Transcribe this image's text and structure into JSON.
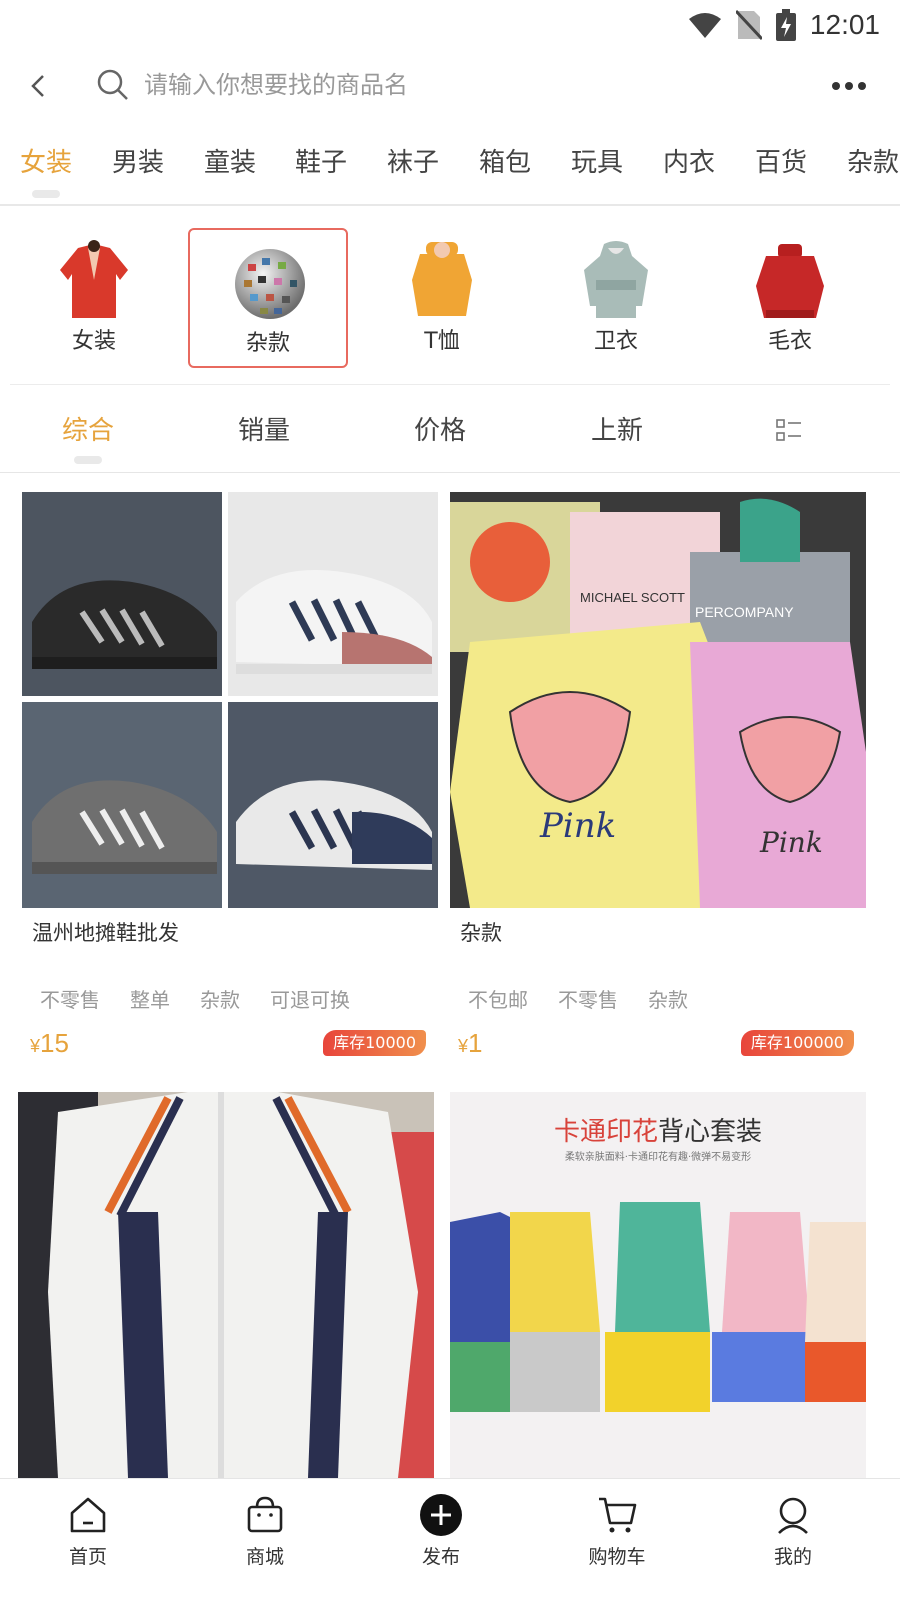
{
  "status_bar": {
    "time": "12:01"
  },
  "search": {
    "placeholder": "请输入你想要找的商品名"
  },
  "category_tabs": [
    {
      "label": "女装",
      "active": true
    },
    {
      "label": "男装"
    },
    {
      "label": "童装"
    },
    {
      "label": "鞋子"
    },
    {
      "label": "袜子"
    },
    {
      "label": "箱包"
    },
    {
      "label": "玩具"
    },
    {
      "label": "内衣"
    },
    {
      "label": "百货"
    },
    {
      "label": "杂款"
    }
  ],
  "subcategories": [
    {
      "label": "女装"
    },
    {
      "label": "杂款",
      "selected": true
    },
    {
      "label": "T恤"
    },
    {
      "label": "卫衣"
    },
    {
      "label": "毛衣"
    }
  ],
  "sort_options": [
    {
      "label": "综合",
      "active": true
    },
    {
      "label": "销量"
    },
    {
      "label": "价格"
    },
    {
      "label": "上新"
    }
  ],
  "products": [
    {
      "title": "温州地摊鞋批发",
      "tags": [
        "不零售",
        "整单",
        "杂款",
        "可退可换"
      ],
      "currency": "¥",
      "price": "15",
      "stock": "库存10000"
    },
    {
      "title": "杂款",
      "tags": [
        "不包邮",
        "不零售",
        "杂款"
      ],
      "currency": "¥",
      "price": "1",
      "stock": "库存100000"
    },
    {
      "title": "",
      "tags": [],
      "currency": "",
      "price": "",
      "stock": ""
    },
    {
      "title": "",
      "image_heading": "卡通印花背心套装",
      "image_heading_accent": "卡通印花",
      "image_heading_rest": "背心套装",
      "image_subheading": "柔软亲肤面料·卡通印花有趣·微弹不易变形",
      "tags": [],
      "currency": "",
      "price": "",
      "stock": ""
    }
  ],
  "bottom_nav": [
    {
      "label": "首页",
      "icon": "home-icon"
    },
    {
      "label": "商城",
      "icon": "shopping-bag-icon"
    },
    {
      "label": "发布",
      "icon": "plus-circle-icon"
    },
    {
      "label": "购物车",
      "icon": "cart-icon"
    },
    {
      "label": "我的",
      "icon": "user-icon"
    }
  ],
  "colors": {
    "accent": "#e6a33c",
    "selected_border": "#e86a5f",
    "stock_badge": "#e8453b"
  }
}
